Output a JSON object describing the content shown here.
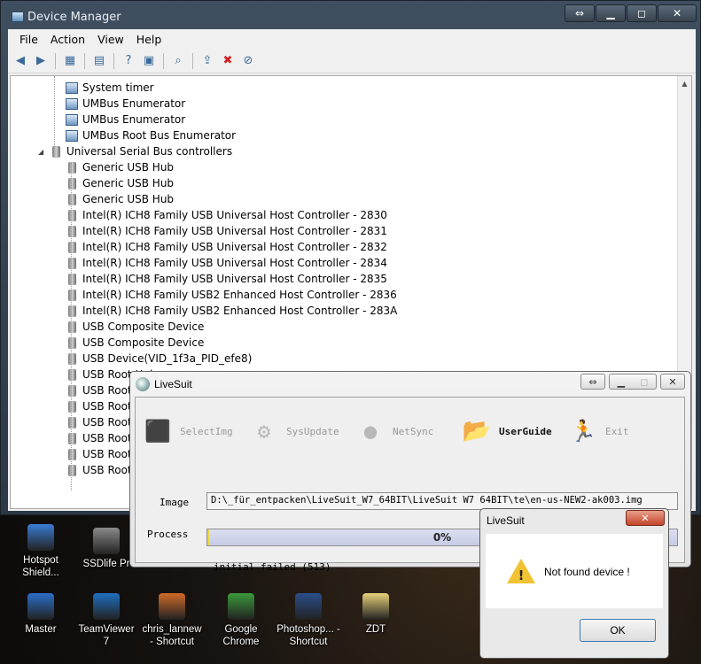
{
  "device_manager": {
    "title": "Device Manager",
    "menu": [
      "File",
      "Action",
      "View",
      "Help"
    ],
    "tree": [
      {
        "label": "System timer",
        "level": 2,
        "icon": "system-device-icon"
      },
      {
        "label": "UMBus Enumerator",
        "level": 2,
        "icon": "system-device-icon"
      },
      {
        "label": "UMBus Enumerator",
        "level": 2,
        "icon": "system-device-icon"
      },
      {
        "label": "UMBus Root Bus Enumerator",
        "level": 2,
        "icon": "system-device-icon"
      },
      {
        "label": "Universal Serial Bus controllers",
        "level": 1,
        "icon": "usb-icon",
        "expanded": true
      },
      {
        "label": "Generic USB Hub",
        "level": 2,
        "icon": "usb-icon"
      },
      {
        "label": "Generic USB Hub",
        "level": 2,
        "icon": "usb-icon"
      },
      {
        "label": "Generic USB Hub",
        "level": 2,
        "icon": "usb-icon"
      },
      {
        "label": "Intel(R) ICH8 Family USB Universal Host Controller - 2830",
        "level": 2,
        "icon": "usb-icon"
      },
      {
        "label": "Intel(R) ICH8 Family USB Universal Host Controller - 2831",
        "level": 2,
        "icon": "usb-icon"
      },
      {
        "label": "Intel(R) ICH8 Family USB Universal Host Controller - 2832",
        "level": 2,
        "icon": "usb-icon"
      },
      {
        "label": "Intel(R) ICH8 Family USB Universal Host Controller - 2834",
        "level": 2,
        "icon": "usb-icon"
      },
      {
        "label": "Intel(R) ICH8 Family USB Universal Host Controller - 2835",
        "level": 2,
        "icon": "usb-icon"
      },
      {
        "label": "Intel(R) ICH8 Family USB2 Enhanced Host Controller - 2836",
        "level": 2,
        "icon": "usb-icon"
      },
      {
        "label": "Intel(R) ICH8 Family USB2 Enhanced Host Controller - 283A",
        "level": 2,
        "icon": "usb-icon"
      },
      {
        "label": "USB Composite Device",
        "level": 2,
        "icon": "usb-icon"
      },
      {
        "label": "USB Composite Device",
        "level": 2,
        "icon": "usb-icon"
      },
      {
        "label": "USB Device(VID_1f3a_PID_efe8)",
        "level": 2,
        "icon": "usb-icon"
      },
      {
        "label": "USB Root Hub",
        "level": 2,
        "icon": "usb-icon"
      },
      {
        "label": "USB Root Hub",
        "level": 2,
        "icon": "usb-icon"
      },
      {
        "label": "USB Root Hub",
        "level": 2,
        "icon": "usb-icon"
      },
      {
        "label": "USB Root Hub",
        "level": 2,
        "icon": "usb-icon"
      },
      {
        "label": "USB Root Hub",
        "level": 2,
        "icon": "usb-icon"
      },
      {
        "label": "USB Root Hub",
        "level": 2,
        "icon": "usb-icon"
      },
      {
        "label": "USB Root Hub",
        "level": 2,
        "icon": "usb-icon"
      }
    ]
  },
  "desktop_icons": [
    {
      "label": "Hotspot Shield...",
      "color": "#3a7bd5"
    },
    {
      "label": "SSDlife Pr",
      "color": "#8a8a8a"
    },
    {
      "label": "Master",
      "color": "#2a6fc9"
    },
    {
      "label": "TeamViewer 7",
      "color": "#1e6fc0"
    },
    {
      "label": "chris_lannew - Shortcut",
      "color": "#d06a28"
    },
    {
      "label": "Google Chrome",
      "color": "#3a9a3a"
    },
    {
      "label": "Photoshop... - Shortcut",
      "color": "#2a4e8a"
    },
    {
      "label": "ZDT",
      "color": "#e6d27a"
    }
  ],
  "livesuit": {
    "title": "LiveSuit",
    "toolbar": [
      {
        "label": "SelectImg",
        "icon": "select-img-icon",
        "active": false
      },
      {
        "label": "SysUpdate",
        "icon": "sys-update-icon",
        "active": false
      },
      {
        "label": "NetSync",
        "icon": "net-sync-icon",
        "active": false
      },
      {
        "label": "UserGuide",
        "icon": "user-guide-icon",
        "active": true
      },
      {
        "label": "Exit",
        "icon": "exit-icon",
        "active": false
      }
    ],
    "image_label": "Image",
    "image_path": "D:\\_für_entpacken\\LiveSuit_W7_64BIT\\LiveSuit W7 64BIT\\te\\en-us-NEW2-ak003.img",
    "process_label": "Process",
    "progress_text": "0%",
    "progress": 0,
    "status": "initial failed (513)"
  },
  "message_box": {
    "title": "LiveSuit",
    "text": "Not found device !",
    "ok_label": "OK"
  }
}
